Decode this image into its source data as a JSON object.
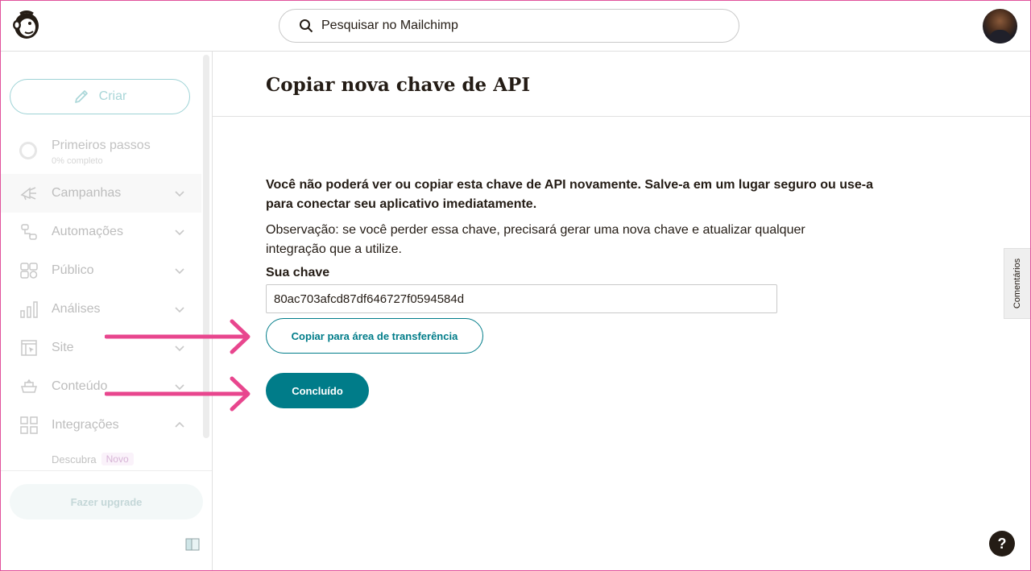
{
  "header": {
    "search_placeholder": "Pesquisar no Mailchimp"
  },
  "sidebar": {
    "create_label": "Criar",
    "first_steps": {
      "title": "Primeiros passos",
      "progress": "0% completo"
    },
    "items": [
      {
        "label": "Campanhas",
        "icon": "megaphone-icon",
        "expanded": false
      },
      {
        "label": "Automações",
        "icon": "automation-icon",
        "expanded": false
      },
      {
        "label": "Público",
        "icon": "audience-icon",
        "expanded": false
      },
      {
        "label": "Análises",
        "icon": "analytics-icon",
        "expanded": false
      },
      {
        "label": "Site",
        "icon": "website-icon",
        "expanded": false
      },
      {
        "label": "Conteúdo",
        "icon": "content-icon",
        "expanded": false
      },
      {
        "label": "Integrações",
        "icon": "integrations-icon",
        "expanded": true
      }
    ],
    "sub_item": {
      "label": "Descubra",
      "badge": "Novo"
    },
    "upgrade_label": "Fazer upgrade"
  },
  "main": {
    "title": "Copiar nova chave de API",
    "warning": "Você não poderá ver ou copiar esta chave de API novamente. Salve-a em um lugar seguro ou use-a para conectar seu aplicativo imediatamente.",
    "note": "Observação: se você perder essa chave, precisará gerar uma nova chave e atualizar qualquer integração que a utilize.",
    "key_label": "Sua chave",
    "key_value": "80ac703afcd87df646727f0594584d",
    "copy_button": "Copiar para área de transferência",
    "done_button": "Concluído"
  },
  "feedback_tab": "Comentários",
  "help_label": "?",
  "colors": {
    "brand_teal": "#007c89",
    "annotation_arrow": "#e8468e",
    "text": "#241c15"
  }
}
